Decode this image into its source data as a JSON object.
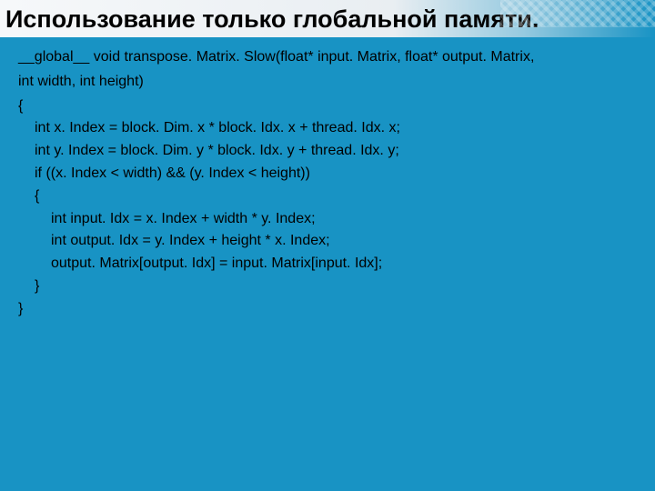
{
  "title": "Использование только глобальной памяти.",
  "code": {
    "sig1": "__global__ void transpose. Matrix. Slow(float* input. Matrix, float* output. Matrix,",
    "sig2": "int width, int height)",
    "brace_open": "{",
    "l1": "int x. Index = block. Dim. x * block. Idx. x + thread. Idx. x;",
    "l2": "int y. Index = block. Dim. y * block. Idx. y + thread. Idx. y;",
    "l3": "if ((x. Index < width) && (y. Index < height))",
    "l4": "{",
    "l5": "int input. Idx = x. Index + width * y. Index;",
    "l6": "int output. Idx = y. Index + height * x. Index;",
    "l7": "output. Matrix[output. Idx] = input. Matrix[input. Idx];",
    "l8": "}",
    "brace_close": "}"
  }
}
